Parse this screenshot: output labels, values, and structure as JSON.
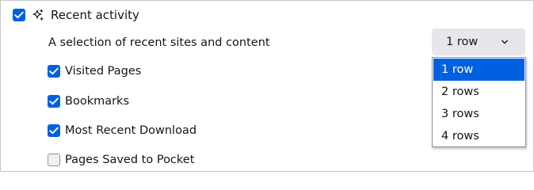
{
  "section": {
    "title": "Recent activity",
    "checked": true,
    "description": "A selection of recent sites and content"
  },
  "rows_select": {
    "value": "1 row",
    "options": [
      "1 row",
      "2 rows",
      "3 rows",
      "4 rows"
    ],
    "selected_index": 0
  },
  "options": [
    {
      "label": "Visited Pages",
      "checked": true
    },
    {
      "label": "Bookmarks",
      "checked": true
    },
    {
      "label": "Most Recent Download",
      "checked": true
    },
    {
      "label": "Pages Saved to Pocket",
      "checked": false
    }
  ],
  "colors": {
    "accent": "#0061e0",
    "select_bg": "#e7e7eb",
    "text": "#15141a"
  },
  "icons": {
    "header": "sparkle-icon",
    "select": "chevron-down-icon",
    "check": "checkmark-icon"
  }
}
